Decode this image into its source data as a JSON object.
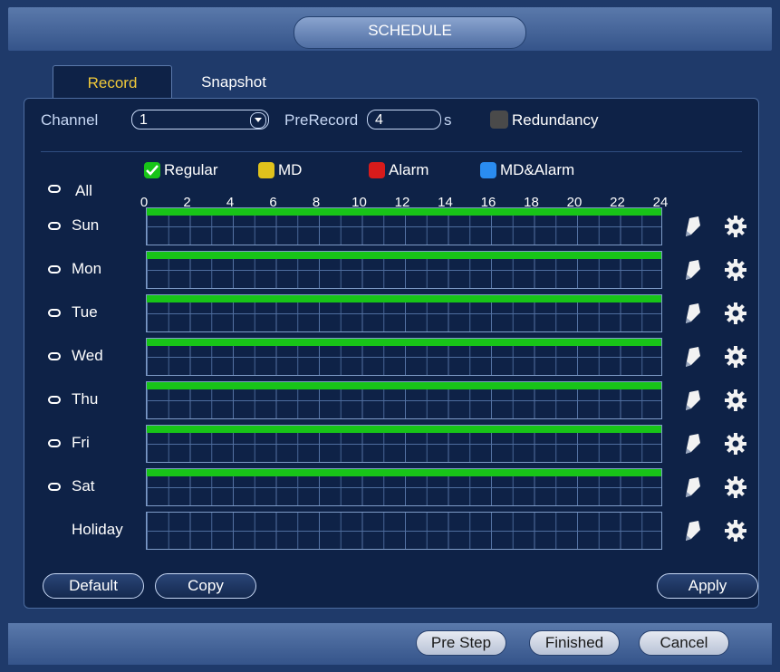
{
  "title": "SCHEDULE",
  "tabs": [
    {
      "label": "Record",
      "active": true
    },
    {
      "label": "Snapshot",
      "active": false
    }
  ],
  "channel": {
    "label": "Channel",
    "value": "1"
  },
  "prerecord": {
    "label": "PreRecord",
    "value": "4",
    "unit": "s"
  },
  "redundancy": {
    "label": "Redundancy",
    "checked": false
  },
  "all_label": "All",
  "legend": [
    {
      "label": "Regular",
      "color": "#18c418",
      "checked": true
    },
    {
      "label": "MD",
      "color": "#e0c21c",
      "checked": false
    },
    {
      "label": "Alarm",
      "color": "#d81b1b",
      "checked": false
    },
    {
      "label": "MD&Alarm",
      "color": "#2a8cf0",
      "checked": false
    }
  ],
  "hours": [
    "0",
    "2",
    "4",
    "6",
    "8",
    "10",
    "12",
    "14",
    "16",
    "18",
    "20",
    "22",
    "24"
  ],
  "days": [
    {
      "label": "Sun",
      "regular_coverage": 1.0
    },
    {
      "label": "Mon",
      "regular_coverage": 1.0
    },
    {
      "label": "Tue",
      "regular_coverage": 1.0
    },
    {
      "label": "Wed",
      "regular_coverage": 1.0
    },
    {
      "label": "Thu",
      "regular_coverage": 1.0
    },
    {
      "label": "Fri",
      "regular_coverage": 1.0
    },
    {
      "label": "Sat",
      "regular_coverage": 1.0
    },
    {
      "label": "Holiday",
      "regular_coverage": 0.0
    }
  ],
  "buttons": {
    "default": "Default",
    "copy": "Copy",
    "apply": "Apply",
    "prestep": "Pre Step",
    "finished": "Finished",
    "cancel": "Cancel"
  }
}
